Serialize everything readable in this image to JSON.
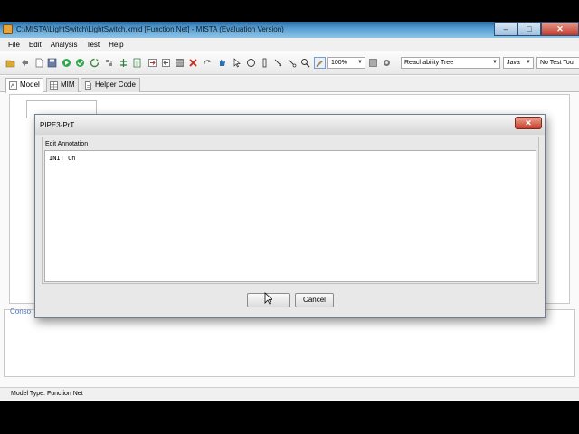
{
  "window": {
    "title": "C:\\MISTA\\LightSwitch\\LightSwitch.xmid [Function Net] - MISTA (Evaluation Version)",
    "minimize_label": "–",
    "maximize_label": "□",
    "close_label": "✕"
  },
  "menubar": {
    "items": [
      "File",
      "Edit",
      "Analysis",
      "Test",
      "Help"
    ]
  },
  "toolbar": {
    "zoom_value": "100%",
    "tree_type_value": "Reachability Tree",
    "language_value": "Java",
    "test_option_value": "No Test Tou"
  },
  "tabs": [
    {
      "label": "Model",
      "active": true
    },
    {
      "label": "MIM",
      "active": false
    },
    {
      "label": "Helper Code",
      "active": false
    }
  ],
  "console": {
    "tab_label": "Conso"
  },
  "status": {
    "model_type": "Model Type: Function Net"
  },
  "dialog": {
    "title": "PIPE3-PrT",
    "close_label": "✕",
    "panel_label": "Edit Annotation",
    "annotation_text": "INIT On",
    "ok_label": "",
    "cancel_label": "Cancel"
  },
  "colors": {
    "titlebar_accent": "#5aa3d6",
    "close_red": "#c63d2b",
    "console_tab_blue": "#4a73b8"
  }
}
